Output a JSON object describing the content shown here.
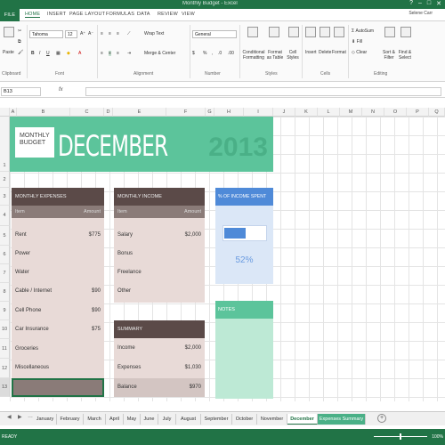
{
  "window": {
    "title": "Monthly Budget - Excel",
    "user": "Selene Carr"
  },
  "ribbon_tabs": [
    "FILE",
    "HOME",
    "INSERT",
    "PAGE LAYOUT",
    "FORMULAS",
    "DATA",
    "REVIEW",
    "VIEW"
  ],
  "ribbon": {
    "font_name": "Tahoma",
    "font_size": "12",
    "number_format": "General",
    "wrap_text": "Wrap Text",
    "merge_center": "Merge & Center",
    "conditional_formatting": "Conditional Formatting",
    "format_as_table": "Format as Table",
    "cell_styles": "Cell Styles",
    "insert": "Insert",
    "delete": "Delete",
    "format": "Format",
    "autosum": "AutoSum",
    "fill": "Fill",
    "clear": "Clear",
    "sort_filter": "Sort & Filter",
    "find_select": "Find & Select",
    "paste": "Paste",
    "groups": [
      "Clipboard",
      "Font",
      "Alignment",
      "Number",
      "Styles",
      "Cells",
      "Editing"
    ]
  },
  "formula_bar": {
    "name_box": "B13",
    "fx": "fx",
    "value": ""
  },
  "columns": [
    "A",
    "B",
    "C",
    "D",
    "E",
    "F",
    "G",
    "H",
    "I",
    "J",
    "K",
    "L",
    "M",
    "N",
    "O",
    "P",
    "Q"
  ],
  "rows": [
    "1",
    "2",
    "3",
    "4",
    "5",
    "6",
    "7",
    "8",
    "9",
    "10",
    "11",
    "12",
    "13"
  ],
  "banner": {
    "logo_line1": "MONTHLY",
    "logo_line2": "BUDGET",
    "month": "DECEMBER",
    "year": "2013"
  },
  "monthly_expenses": {
    "title": "MONTHLY EXPENSES",
    "col_item": "Item",
    "col_amount": "Amount",
    "items": [
      {
        "label": "Rent",
        "amount": "$775"
      },
      {
        "label": "Power",
        "amount": ""
      },
      {
        "label": "Water",
        "amount": ""
      },
      {
        "label": "Cable / Internet",
        "amount": "$90"
      },
      {
        "label": "Cell Phone",
        "amount": "$90"
      },
      {
        "label": "Car Insurance",
        "amount": "$75"
      },
      {
        "label": "Groceries",
        "amount": ""
      },
      {
        "label": "Miscellaneous",
        "amount": ""
      }
    ]
  },
  "monthly_income": {
    "title": "MONTHLY INCOME",
    "col_item": "Item",
    "col_amount": "Amount",
    "items": [
      {
        "label": "Salary",
        "amount": "$2,000"
      },
      {
        "label": "Bonus",
        "amount": ""
      },
      {
        "label": "Freelance",
        "amount": ""
      },
      {
        "label": "Other",
        "amount": ""
      }
    ]
  },
  "summary": {
    "title": "SUMMARY",
    "items": [
      {
        "label": "Income",
        "amount": "$2,000"
      },
      {
        "label": "Expenses",
        "amount": "$1,030"
      },
      {
        "label": "Balance",
        "amount": "$970"
      }
    ]
  },
  "percent_spent": {
    "title": "% OF INCOME SPENT",
    "value": "52%",
    "fraction": 0.52
  },
  "notes": {
    "title": "NOTES"
  },
  "sheet_tabs": [
    "January",
    "February",
    "March",
    "April",
    "May",
    "June",
    "July",
    "August",
    "September",
    "October",
    "November",
    "December",
    "Expenses Summary"
  ],
  "active_sheet": "December",
  "status": {
    "ready": "READY",
    "zoom": "100%"
  },
  "colors": {
    "excel_green": "#217346",
    "banner_green": "#5cc49b",
    "table_brown": "#5b4a48",
    "row_pink": "#e8dad7",
    "pct_blue": "#4f8ad8"
  }
}
